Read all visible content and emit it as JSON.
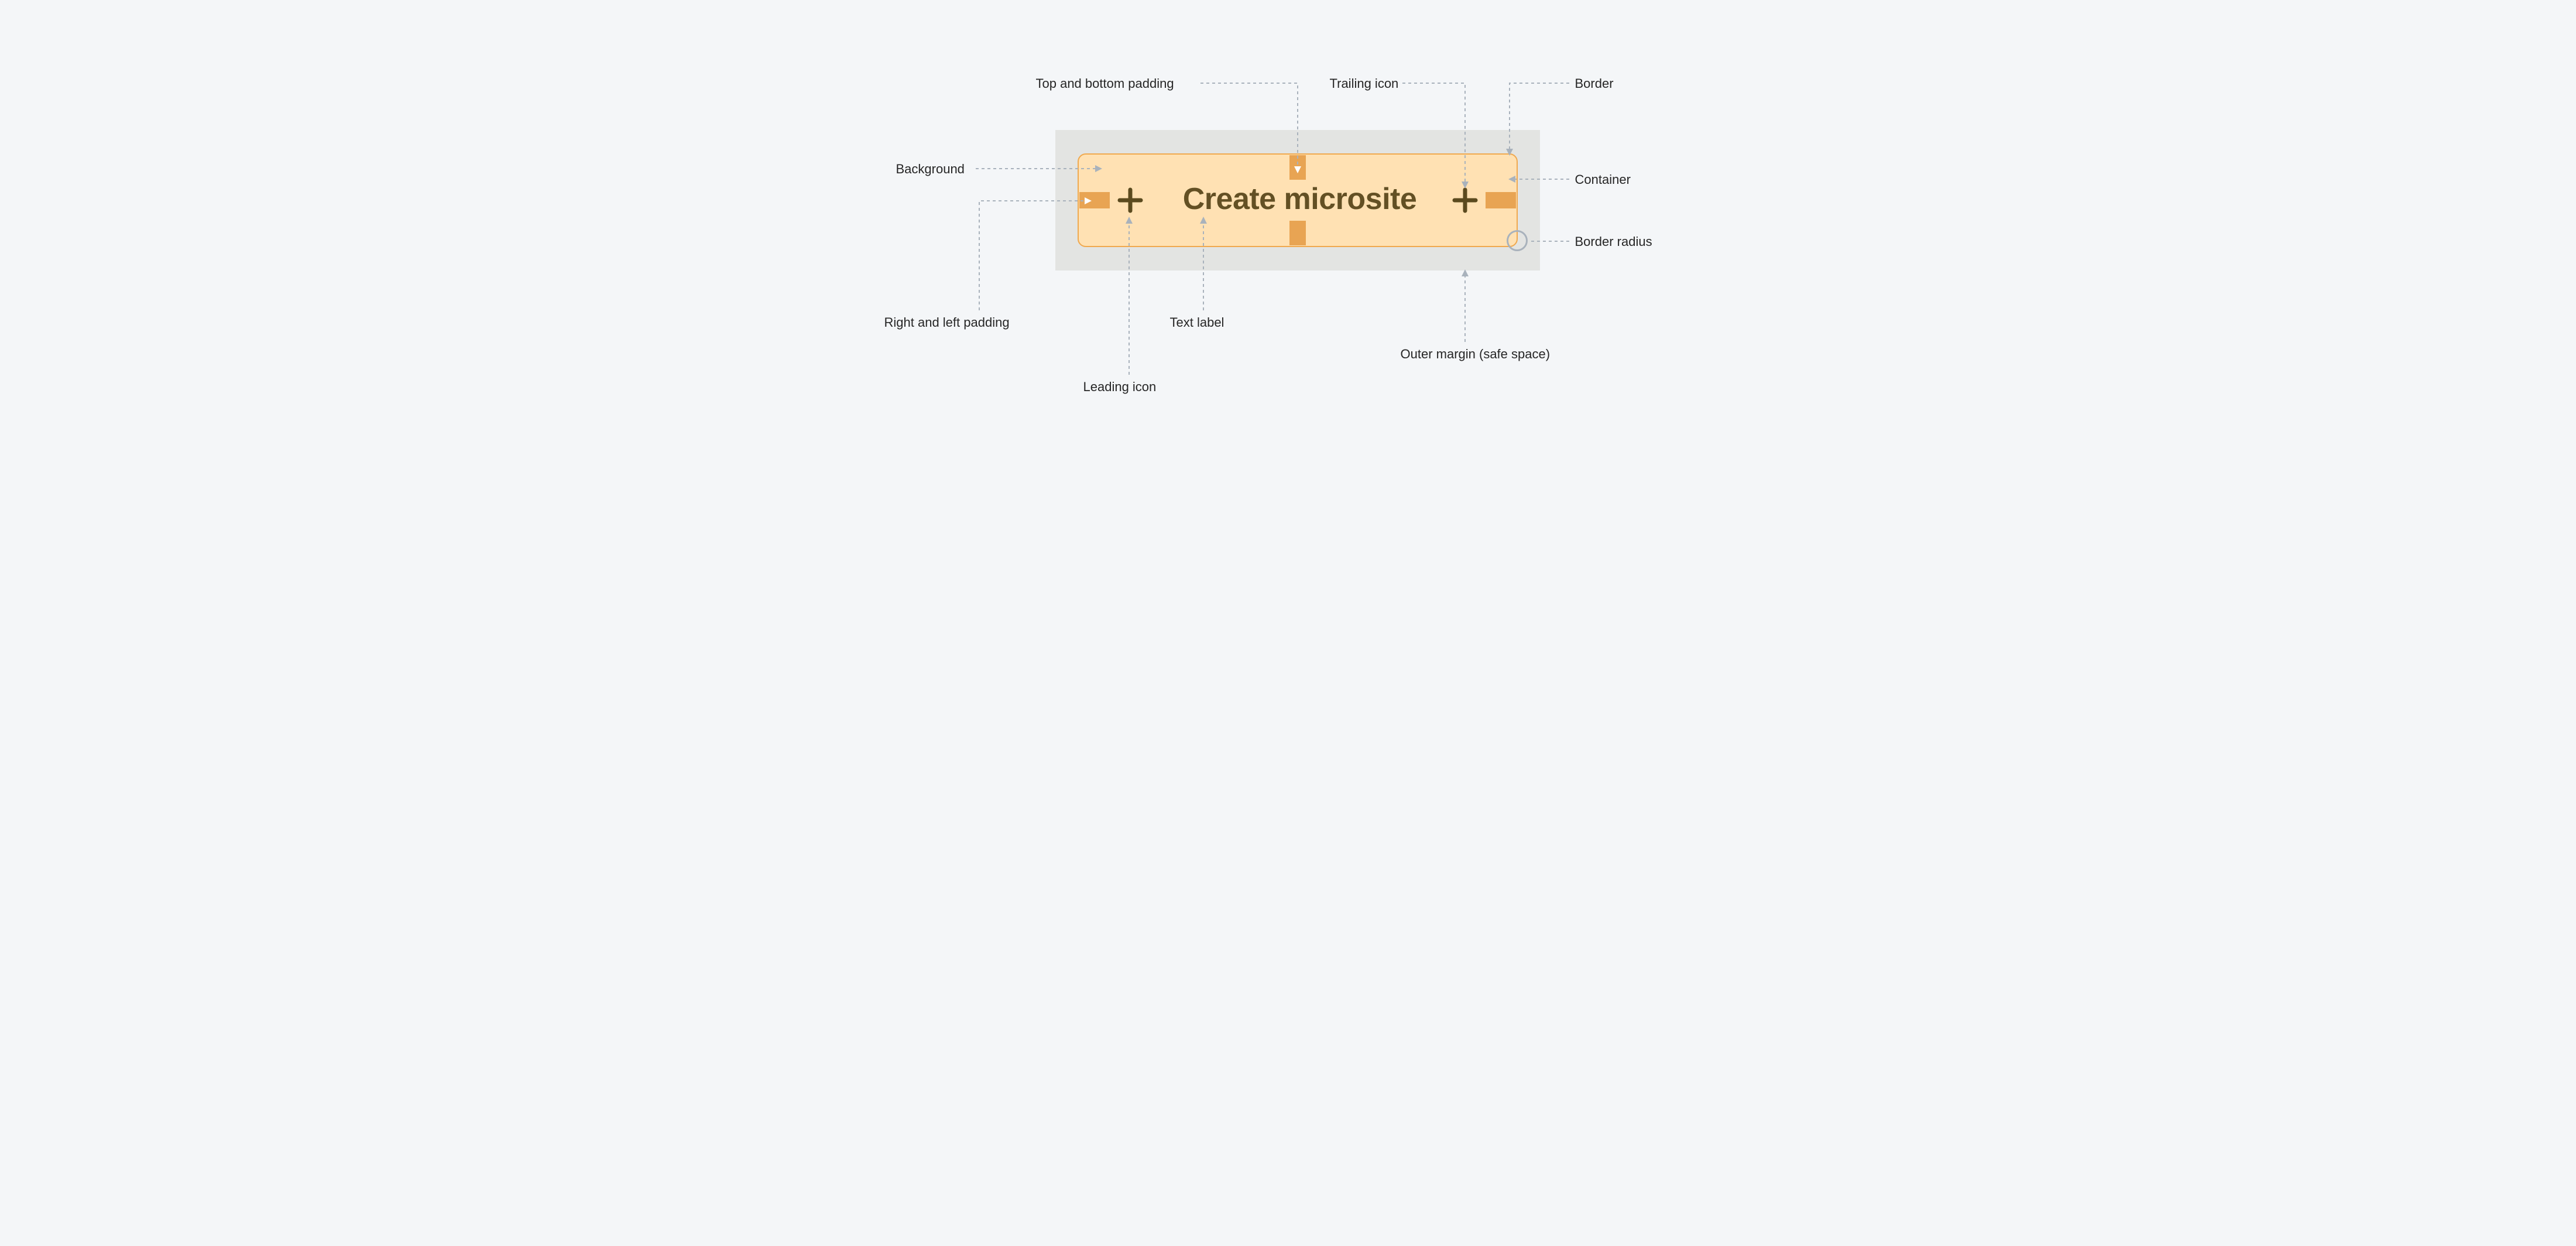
{
  "button": {
    "text_label": "Create microsite",
    "leading_icon": "plus",
    "trailing_icon": "plus"
  },
  "annotations": {
    "top_bottom_padding": "Top and bottom padding",
    "trailing_icon": "Trailing icon",
    "border": "Border",
    "background": "Background",
    "container": "Container",
    "border_radius": "Border radius",
    "right_left_padding": "Right and left padding",
    "text_label": "Text label",
    "outer_margin": "Outer margin (safe space)",
    "leading_icon": "Leading icon"
  },
  "colors": {
    "page_bg": "#f4f6f8",
    "safe_space": "#e3e4e2",
    "button_bg": "#ffe1b3",
    "button_border": "#f0a94f",
    "padding_strip": "#e8a453",
    "text": "#635024",
    "connector": "#a9b2bc"
  }
}
